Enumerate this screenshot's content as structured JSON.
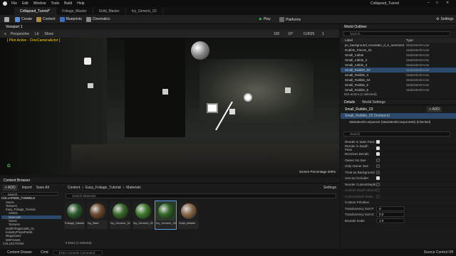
{
  "menu": {
    "items": [
      "File",
      "Edit",
      "Window",
      "Tools",
      "Build",
      "Help"
    ],
    "window_title": "Collapsed_Tunnel"
  },
  "tabs": [
    "Collapsed_Tunnel*",
    "Foliage_Master",
    "Solid_Master",
    "Ivy_Generic_02"
  ],
  "toolbar": {
    "save": "",
    "create": "Create",
    "content": "Content",
    "blueprints": "Blueprints",
    "cinematics": "Cinematics",
    "play": "Play",
    "platforms": "Platforms",
    "settings": "Settings"
  },
  "viewport": {
    "tab": "Viewport 1",
    "perspective": "Perspective",
    "lit": "Lit",
    "show": "Show",
    "pilot": "[ Pilot Active - CineCameraActor ]",
    "grid_snap": "100",
    "rot_snap": "10°",
    "scale_snap": "0.0625",
    "cam_speed": "1",
    "screen_pct": "Screen Percentage  200%",
    "axis_label": "G"
  },
  "outliner": {
    "title": "World Outliner",
    "search_placeholder": "Search...",
    "col_label": "Label",
    "col_type": "Type",
    "rows": [
      {
        "name": "pc_background_mountain_d_S_summer2",
        "type": "StaticMeshActor"
      },
      {
        "name": "Rubble_Pieces_01",
        "type": "StaticMeshActor"
      },
      {
        "name": "Small_rubble",
        "type": "StaticMeshActor"
      },
      {
        "name": "Small_rubble_2",
        "type": "StaticMeshActor"
      },
      {
        "name": "Small_rubble_3",
        "type": "StaticMeshActor"
      },
      {
        "name": "Small_Rubble_03",
        "type": "StaticMeshActor"
      },
      {
        "name": "Small_Rubble_3",
        "type": "StaticMeshActor"
      },
      {
        "name": "Small_Rubble_04",
        "type": "StaticMeshActor"
      },
      {
        "name": "Small_Rubble_5",
        "type": "StaticMeshActor"
      },
      {
        "name": "Small_Rubble_6",
        "type": "StaticMeshActor"
      }
    ],
    "count": "515 actors (1 selected)"
  },
  "details": {
    "tab_details": "Details",
    "tab_world": "World Settings",
    "actor_name": "Small_Rubble_03",
    "add_btn": "+ ADD",
    "instance": "Small_Rubble_03 (Instance)",
    "component": "StaticMeshComponent (StaticMeshComponent0) (Inherited)",
    "search_placeholder": "Search",
    "props": [
      {
        "label": "Render in Main Pass",
        "checked": true
      },
      {
        "label": "Render in Depth Pass",
        "checked": true
      },
      {
        "label": "Receives Decals",
        "checked": true
      },
      {
        "label": "Owner No See",
        "checked": false
      },
      {
        "label": "Only Owner See",
        "checked": false
      },
      {
        "label": "Treat as Background",
        "checked": false
      },
      {
        "label": "Use as Occluder",
        "checked": true
      },
      {
        "label": "Render CustomDepth",
        "checked": false
      },
      {
        "label": "Custom Depth Stencil",
        "checked": false
      },
      {
        "label": "CustomDepth Mask",
        "checked": false
      }
    ],
    "section": "Custom Primitive",
    "values": [
      {
        "label": "Translucency Sort P",
        "value": "0"
      },
      {
        "label": "Translucency Sort D",
        "value": "0.0"
      },
      {
        "label": "Bounds Scale",
        "value": "1.0"
      }
    ]
  },
  "content": {
    "title": "Content Browser",
    "add": "+ ADD",
    "import": "Import",
    "save_all": "Save All",
    "settings": "Settings",
    "search_placeholder": "Search Materials",
    "breadcrumb": [
      "Content",
      "Easy_Foliage_Tutorial",
      "Materials"
    ],
    "tree_search": "Search",
    "tree_root": "COLLAPSED_TUNNELS",
    "tree": [
      "Saves",
      "Textures",
      "Easy_Foliage_Tutorial",
      "Assets",
      "Materials",
      "Saves",
      "Textures",
      "DraftFilTagDetails_01",
      "IndustryPropsPack6",
      "Megascans",
      "MSPresets"
    ],
    "assets": [
      {
        "name": "Foliage_Master",
        "color": "#2d5a2e"
      },
      {
        "name": "Ivy_Bark",
        "color": "#6b4a2e"
      },
      {
        "name": "Ivy_Generic_01",
        "color": "#3b6b2a"
      },
      {
        "name": "Ivy_Generic_02",
        "color": "#3f7a2c"
      },
      {
        "name": "Ivy_Generic_03",
        "color": "#356a2a"
      },
      {
        "name": "Solid_Master",
        "color": "#8a6a48"
      }
    ],
    "count": "6 items (1 selected)",
    "collections": "COLLECTIONS"
  },
  "status": {
    "drawer": "Content Drawer",
    "cmd": "Cmd",
    "console_placeholder": "Enter Console Command",
    "source": "Source Control Off"
  }
}
